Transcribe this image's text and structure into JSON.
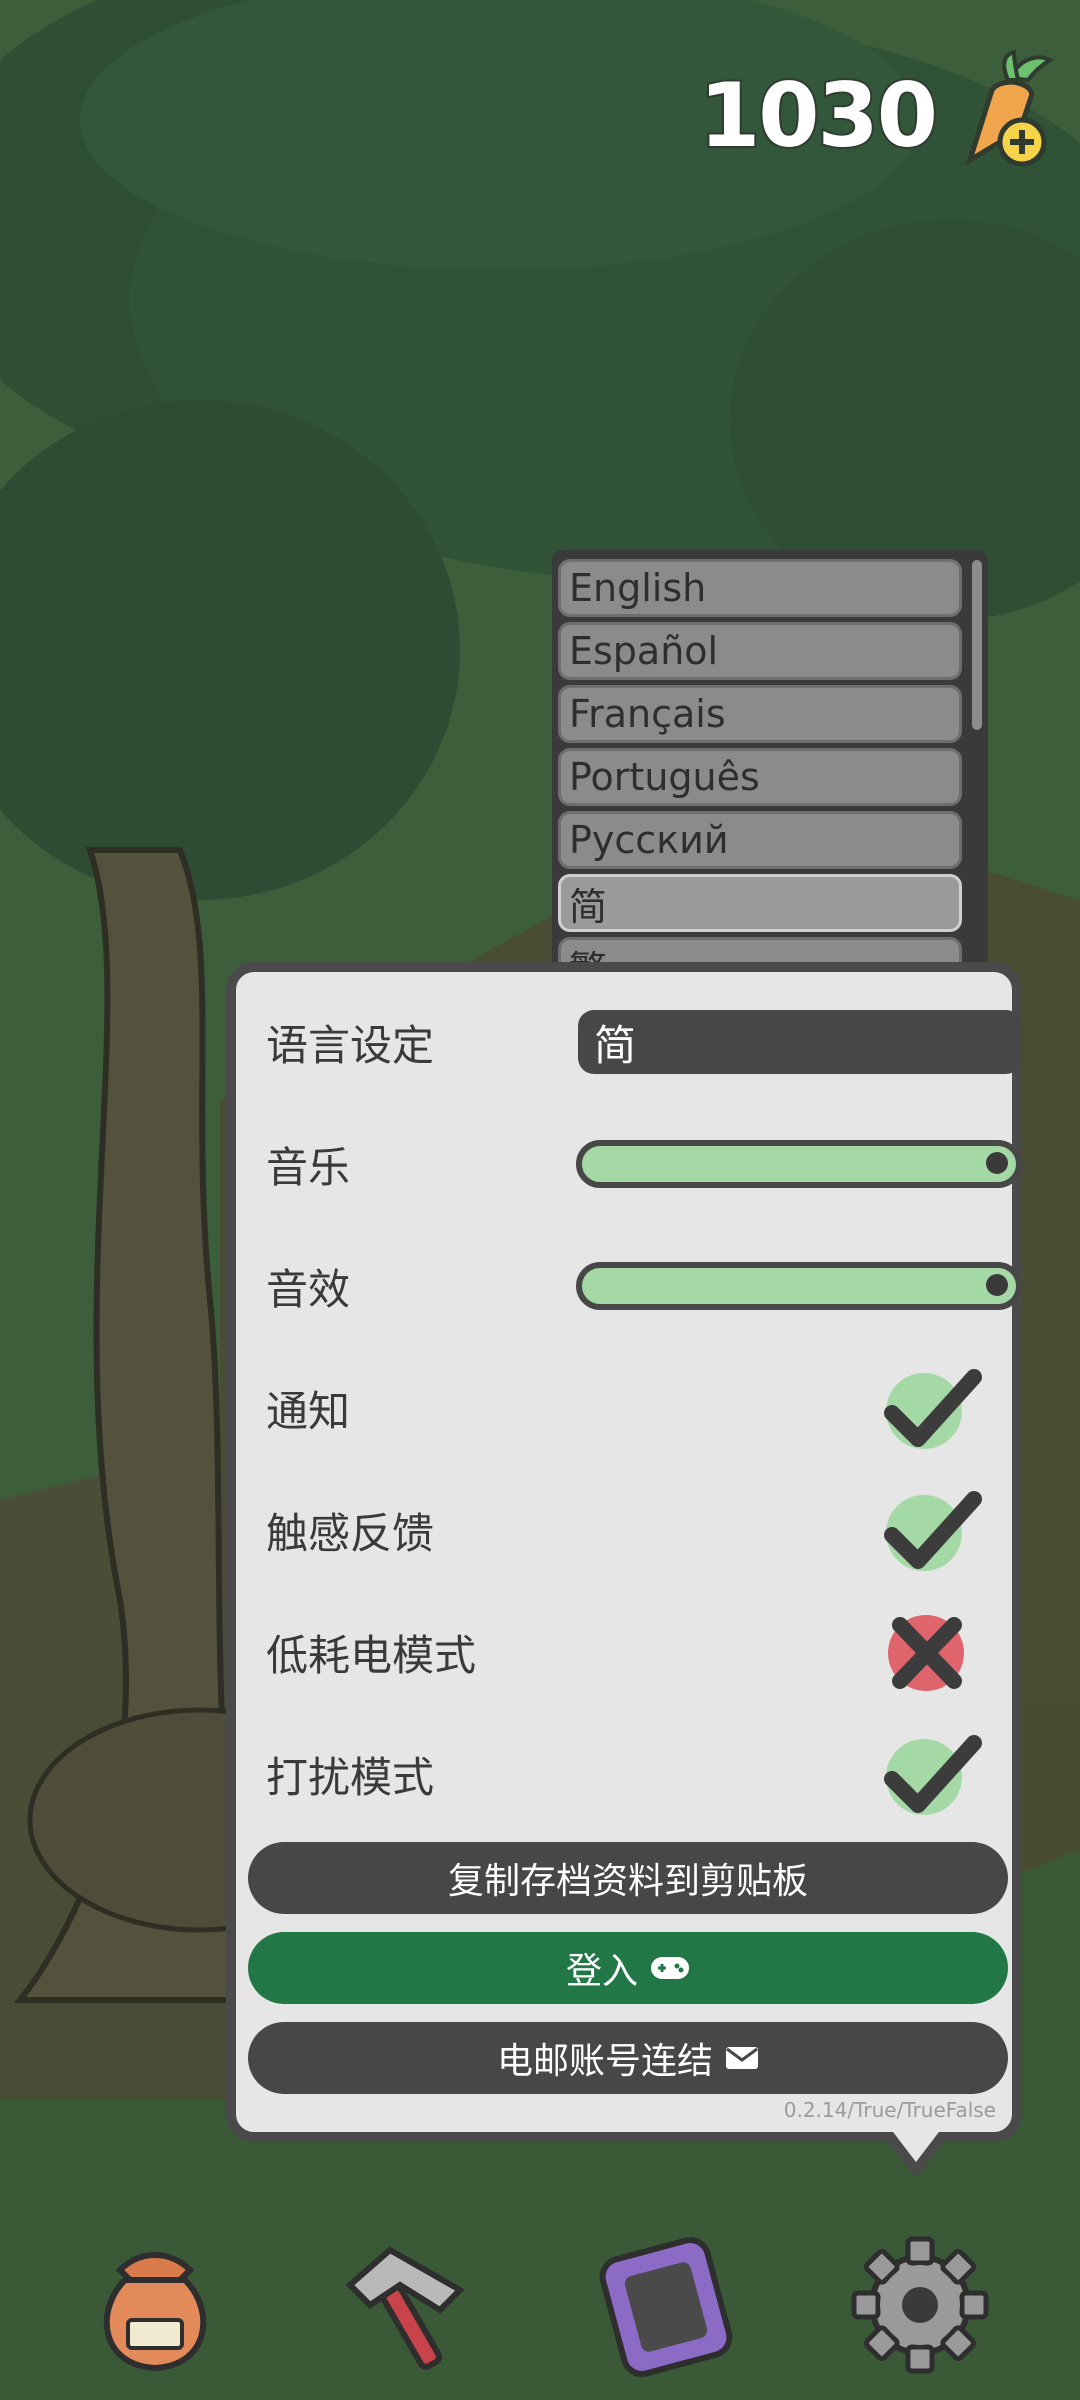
{
  "currency": {
    "amount": "1030",
    "icon": "carrot-plus-icon"
  },
  "language_menu": {
    "options": [
      "English",
      "Español",
      "Français",
      "Português",
      "Русский",
      "简",
      "繁"
    ],
    "selected": "简"
  },
  "settings": {
    "language": {
      "label": "语言设定",
      "value": "简"
    },
    "music": {
      "label": "音乐",
      "level": 1.0
    },
    "sfx": {
      "label": "音效",
      "level": 1.0
    },
    "notifications": {
      "label": "通知",
      "state": "on"
    },
    "haptics": {
      "label": "触感反馈",
      "state": "on"
    },
    "low_power": {
      "label": "低耗电模式",
      "state": "off"
    },
    "dnd": {
      "label": "打扰模式",
      "state": "on"
    },
    "copy_save_label": "复制存档资料到剪贴板",
    "login_label": "登入",
    "email_link_label": "电邮账号连结",
    "version": "0.2.14/True/TrueFalse"
  },
  "bottom_nav": [
    "bag-icon",
    "hammer-icon",
    "tablet-icon",
    "gear-icon"
  ],
  "colors": {
    "panel": "#e6e6e6",
    "dark": "#474747",
    "green": "#217846",
    "slider": "#a4d9a6",
    "check_bg": "#a4d9a6",
    "cross_bg": "#e0646c"
  }
}
